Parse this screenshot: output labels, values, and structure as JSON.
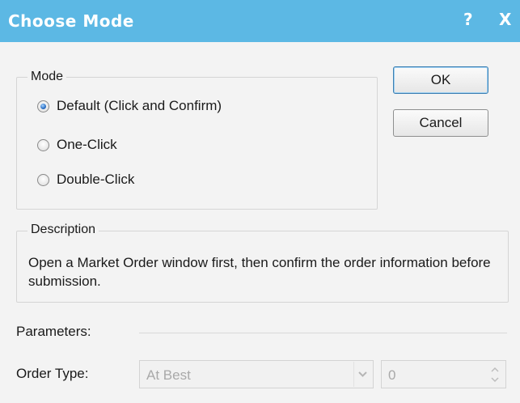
{
  "window": {
    "title": "Choose Mode",
    "help_label": "?",
    "close_label": "X"
  },
  "mode": {
    "legend": "Mode",
    "options": [
      {
        "label": "Default (Click and Confirm)",
        "checked": true
      },
      {
        "label": "One-Click",
        "checked": false
      },
      {
        "label": "Double-Click",
        "checked": false
      }
    ]
  },
  "buttons": {
    "ok_label": "OK",
    "cancel_label": "Cancel"
  },
  "description": {
    "legend": "Description",
    "text": "Open a Market Order window first, then confirm the order information before submission."
  },
  "parameters": {
    "label": "Parameters:",
    "order_type_label": "Order Type:",
    "order_type_value": "At Best",
    "quantity_value": "0"
  },
  "colors": {
    "titlebar": "#5cb8e4",
    "background": "#f3f3f3"
  }
}
